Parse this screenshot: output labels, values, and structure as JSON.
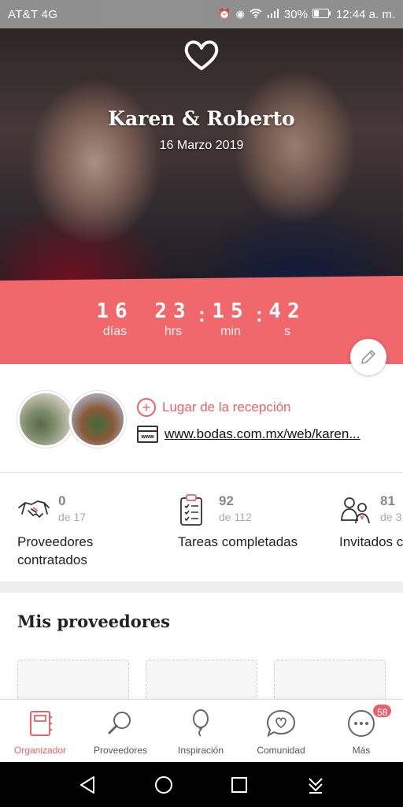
{
  "status_bar": {
    "carrier": "AT&T 4G",
    "battery": "30%",
    "time": "12:44 a. m."
  },
  "hero": {
    "couple_names": "Karen & Roberto",
    "wedding_date": "16 Marzo 2019"
  },
  "countdown": {
    "days": "16",
    "hours": "23",
    "minutes": "15",
    "seconds": "42",
    "days_label": "días",
    "hours_label": "hrs",
    "minutes_label": "min",
    "seconds_label": "s"
  },
  "venue": {
    "add_label": "Lugar de la recepción",
    "website": "www.bodas.com.mx/web/karen..."
  },
  "stats": [
    {
      "icon": "handshake-icon",
      "value": "0",
      "of": "de 17",
      "label": "Proveedores contratados"
    },
    {
      "icon": "clipboard-checklist-icon",
      "value": "92",
      "of": "de 112",
      "label": "Tareas completadas"
    },
    {
      "icon": "guests-icon",
      "value": "81",
      "of": "de 3",
      "label": "Invitados confirmac"
    }
  ],
  "providers": {
    "title": "Mis proveedores"
  },
  "tabs": [
    {
      "label": "Organizador",
      "icon": "notebook-icon",
      "active": true
    },
    {
      "label": "Proveedores",
      "icon": "search-icon",
      "active": false
    },
    {
      "label": "Inspiración",
      "icon": "balloon-icon",
      "active": false
    },
    {
      "label": "Comunidad",
      "icon": "chat-heart-icon",
      "active": false
    },
    {
      "label": "Más",
      "icon": "more-icon",
      "active": false,
      "badge": "58"
    }
  ],
  "colors": {
    "accent": "#f0676c",
    "tab_active": "#e8626a"
  }
}
